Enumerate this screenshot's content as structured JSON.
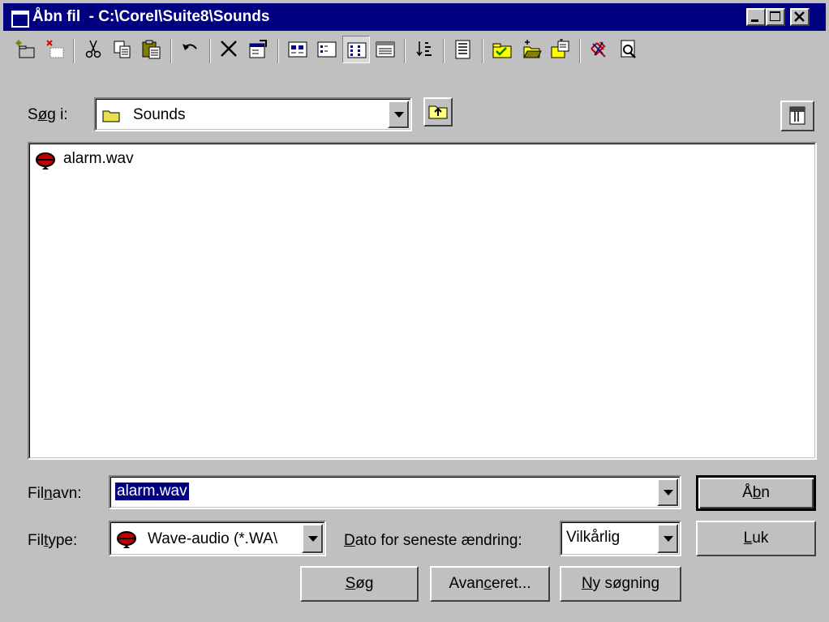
{
  "window": {
    "title": "Åbn fil  - C:\\Corel\\Suite8\\Sounds"
  },
  "toolbar": {
    "icons": [
      "new-folder-icon",
      "delete-folder-icon",
      "cut-icon",
      "copy-icon",
      "paste-icon",
      "undo-icon",
      "delete-icon",
      "properties-icon",
      "large-icons-view-icon",
      "small-icons-view-icon",
      "list-view-icon",
      "details-view-icon",
      "sort-icon",
      "preview-icon",
      "favorites-icon",
      "add-to-favorites-icon",
      "open-favorites-icon",
      "network-icon",
      "quick-view-icon"
    ]
  },
  "lookin": {
    "label_pre": "S",
    "label_u": "ø",
    "label_post": "g i:",
    "value": "Sounds"
  },
  "files": [
    {
      "name": "alarm.wav"
    }
  ],
  "filename": {
    "label_pre": "Fil",
    "label_u": "n",
    "label_post": "avn:",
    "value": "alarm.wav"
  },
  "filetype": {
    "label_pre": "Fil",
    "label_u": "t",
    "label_post": "ype:",
    "value": "Wave-audio (*.WA\\"
  },
  "date_filter": {
    "label_u": "D",
    "label_post": "ato for seneste ændring:",
    "value": "Vilkårlig"
  },
  "buttons": {
    "open": {
      "pre": "Å",
      "u": "b",
      "post": "n"
    },
    "close": {
      "pre": "",
      "u": "L",
      "post": "uk"
    },
    "search": {
      "pre": "",
      "u": "S",
      "post": "øg"
    },
    "advanced": {
      "pre": "Avan",
      "u": "c",
      "post": "eret..."
    },
    "new_search": {
      "pre": "",
      "u": "N",
      "post": "y søgning"
    }
  }
}
